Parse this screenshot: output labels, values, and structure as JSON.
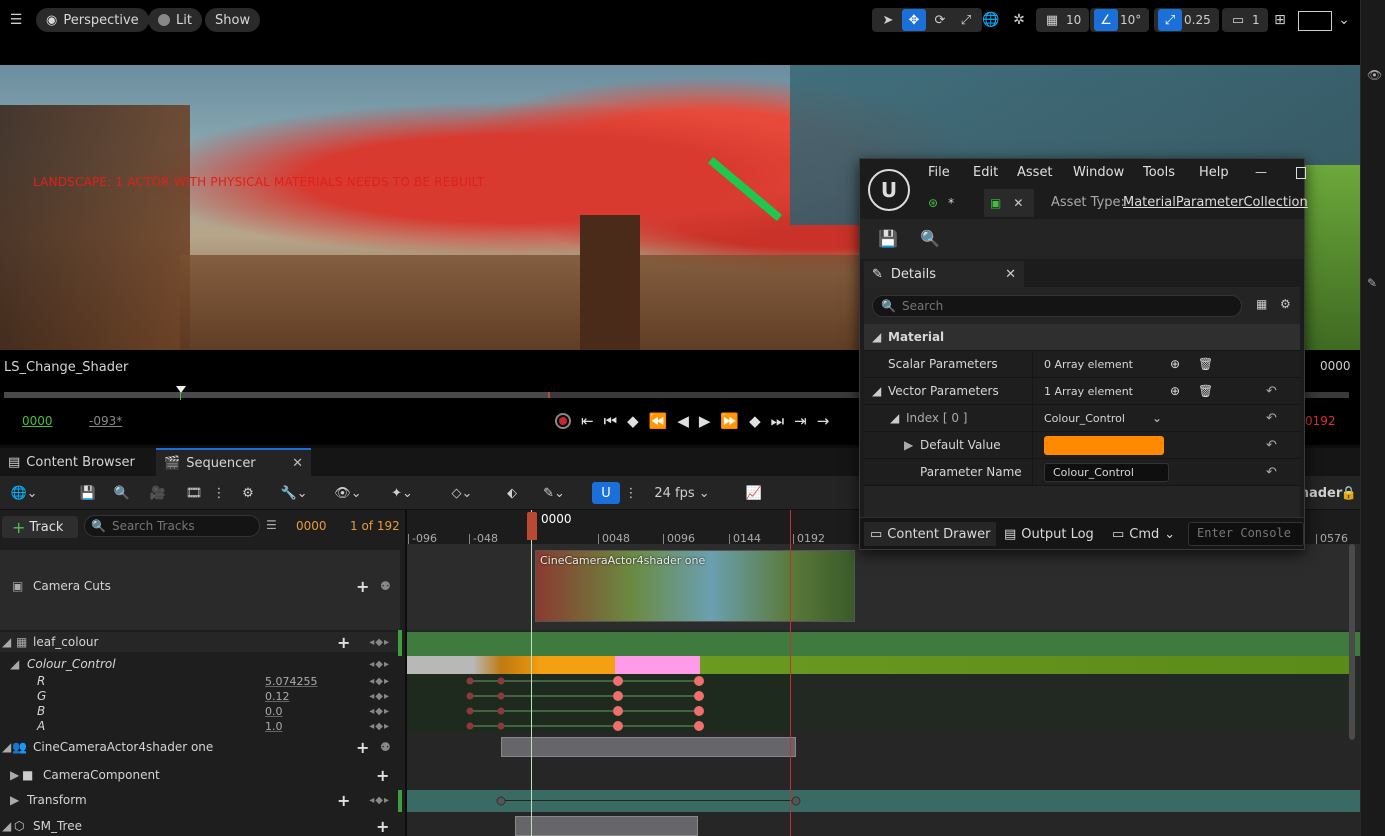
{
  "viewport_toolbar": {
    "menu_icon": "hamburger-icon",
    "perspective_label": "Perspective",
    "lit_label": "Lit",
    "show_label": "Show",
    "grid_snap_value": "10",
    "rotation_snap_value": "10°",
    "scale_snap_value": "0.25",
    "camera_speed_value": "1"
  },
  "viewport": {
    "warning_text": "LANDSCAPE: 1 ACTOR WITH PHYSICAL MATERIALS NEEDS TO BE REBUILT"
  },
  "sequence_strip": {
    "sequence_name": "LS_Change_Shader",
    "start_frame": "0000",
    "offset_frame": "-093*",
    "right_frame": "0000",
    "end_frame": "0192"
  },
  "tabs": {
    "content_browser": "Content Browser",
    "sequencer": "Sequencer"
  },
  "seq_toolbar": {
    "fps_label": "24 fps",
    "shader_label": "hader"
  },
  "outliner": {
    "add_track_label": "Track",
    "search_placeholder": "Search Tracks",
    "current_frame": "0000",
    "frame_count": "1 of 192",
    "rows": {
      "camera_cuts": "Camera Cuts",
      "leaf_colour": "leaf_colour",
      "colour_control": "Colour_Control",
      "r_label": "R",
      "r_value": "5.074255",
      "g_label": "G",
      "g_value": "0.12",
      "b_label": "B",
      "b_value": "0.0",
      "a_label": "A",
      "a_value": "1.0",
      "cine_camera": "CineCameraActor4shader one",
      "camera_component": "CameraComponent",
      "transform": "Transform",
      "sm_tree": "SM_Tree"
    }
  },
  "timeline": {
    "playhead_label": "0000",
    "ticks": [
      "-096",
      "-048",
      "0048",
      "0096",
      "0144",
      "0192",
      "0576"
    ],
    "shot_label": "CineCameraActor4shader one"
  },
  "material_editor": {
    "menu": [
      "File",
      "Edit",
      "Asset",
      "Window",
      "Tools",
      "Help"
    ],
    "asset_type_label": "Asset Type:",
    "asset_type_value": "MaterialParameterCollection",
    "tab_modified_marker": "*",
    "details_tab": "Details",
    "search_placeholder": "Search",
    "section_material": "Material",
    "scalar_params_label": "Scalar Parameters",
    "scalar_params_value": "0 Array element",
    "vector_params_label": "Vector Parameters",
    "vector_params_value": "1 Array element",
    "index_label": "Index [ 0 ]",
    "index_value": "Colour_Control",
    "default_value_label": "Default Value",
    "default_value_color": "#ff8a00",
    "param_name_label": "Parameter Name",
    "param_name_value": "Colour_Control",
    "content_drawer": "Content Drawer",
    "output_log": "Output Log",
    "cmd_label": "Cmd",
    "console_placeholder": "Enter Console C"
  },
  "colors": {
    "accent": "#1a6fd8",
    "playhead": "#b84a32",
    "track_green": "#3f7a3f",
    "key_color": "#ef6e6e"
  }
}
